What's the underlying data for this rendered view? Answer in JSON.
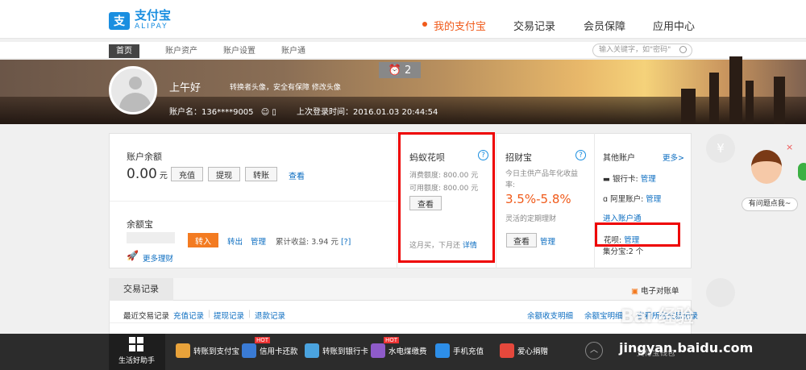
{
  "header": {
    "logo_text": "支付宝",
    "logo_sub": "ALIPAY",
    "nav": [
      "我的支付宝",
      "交易记录",
      "会员保障",
      "应用中心"
    ]
  },
  "subnav": {
    "tabs": [
      "首页",
      "账户资产",
      "账户设置",
      "账户通"
    ],
    "search_placeholder": "输入关键字，如\"密码\""
  },
  "banner": {
    "greeting": "上午好",
    "hint": "转换者头像，安全有保障 修改头像",
    "account": "账户名：136****9005",
    "last_login": "上次登录时间：2016.01.03 20:44:54",
    "alarm_count": "2"
  },
  "balance": {
    "title": "账户余额",
    "amount": "0.00",
    "unit": "元",
    "buttons": [
      "充值",
      "提现",
      "转账"
    ],
    "view": "查看"
  },
  "yuebao": {
    "title": "余额宝",
    "transfer_in": "转入",
    "transfer_out": "转出",
    "manage": "管理",
    "profit": "累计收益: 3.94 元",
    "profit_suffix": "[?]",
    "more": "更多理财"
  },
  "huabei": {
    "title": "蚂蚁花呗",
    "spend_limit": "消费额度: 800.00 元",
    "available": "可用额度: 800.00 元",
    "view": "查看",
    "footer": "这月买，下月还",
    "details": "详情"
  },
  "zhaocai": {
    "title": "招财宝",
    "desc": "今日主供产品年化收益率:",
    "rate": "3.5%-5.8%",
    "tip": "灵活的定期理财",
    "view": "查看",
    "manage": "管理"
  },
  "others": {
    "title": "其他账户",
    "more": "更多>",
    "bank": "银行卡:",
    "bank_link": "管理",
    "ali": "阿里账户:",
    "ali_link": "管理",
    "enter": "进入账户通",
    "huabei": "花呗:",
    "huabei_link": "管理",
    "jifen": "集分宝:2 个"
  },
  "transactions": {
    "tab": "交易记录",
    "statement": "电子对账单",
    "recent": "最近交易记录",
    "filters": [
      "充值记录",
      "提现记录",
      "退款记录"
    ],
    "right_links": [
      "余额收支明细",
      "余额宝明细",
      "查看所有交易记录"
    ]
  },
  "side": {
    "bubble": "有问题点我~",
    "yuan": "¥"
  },
  "bottom": {
    "helper": "生活好助手",
    "items": [
      "转账到支付宝",
      "信用卡还款",
      "转账到银行卡",
      "水电煤缴费",
      "手机充值",
      "爱心捐赠"
    ],
    "hot": "HOT",
    "wallet": "支付宝钱包"
  },
  "watermark": {
    "text": "Bai 经验",
    "url": "jingyan.baidu.com"
  }
}
